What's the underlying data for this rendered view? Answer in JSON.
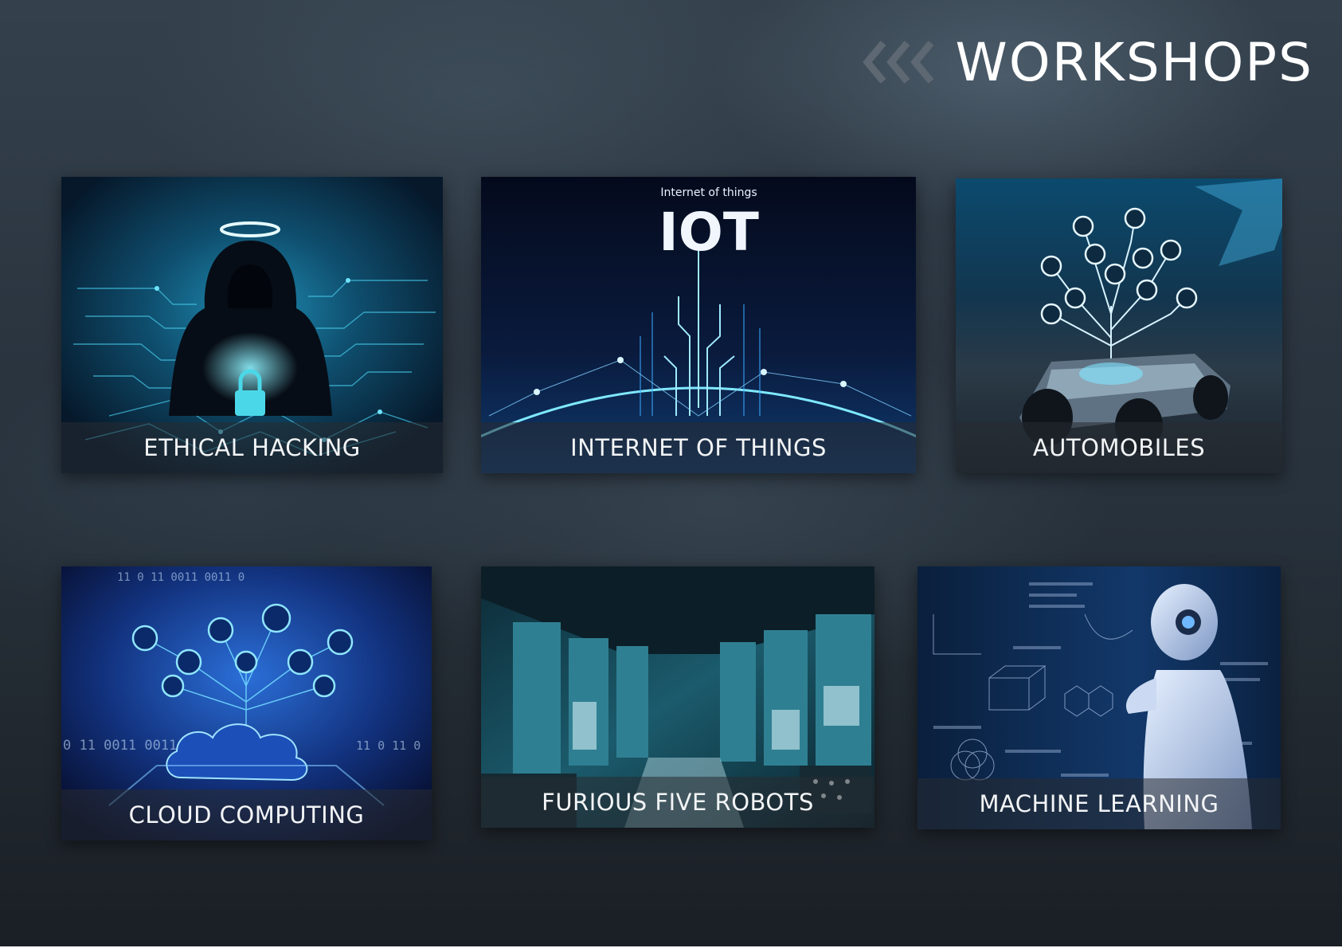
{
  "header": {
    "title": "WORKSHOPS",
    "chevron_icon": "triple-chevron-left-icon",
    "chevron_color": "#5d6872"
  },
  "cards": [
    {
      "label": "ETHICAL HACKING",
      "image": "hooded-hacker-illustration"
    },
    {
      "label": "INTERNET OF THINGS",
      "image": "iot-globe-illustration",
      "image_caption": "Internet of things",
      "image_heading": "IOT"
    },
    {
      "label": "AUTOMOBILES",
      "image": "connected-car-chassis-illustration"
    },
    {
      "label": "CLOUD COMPUTING",
      "image": "cloud-network-illustration",
      "binary_text": [
        "11 0 11 0011 0011 0",
        "0 11 0011 0011",
        "11 0 11 0"
      ]
    },
    {
      "label": "FURIOUS FIVE ROBOTS",
      "image": "factory-machinery-photo"
    },
    {
      "label": "MACHINE LEARNING",
      "image": "thinking-robot-with-formulas"
    }
  ],
  "colors": {
    "background": "#27313b",
    "accent": "#2aa6e0",
    "text": "#ffffff"
  }
}
